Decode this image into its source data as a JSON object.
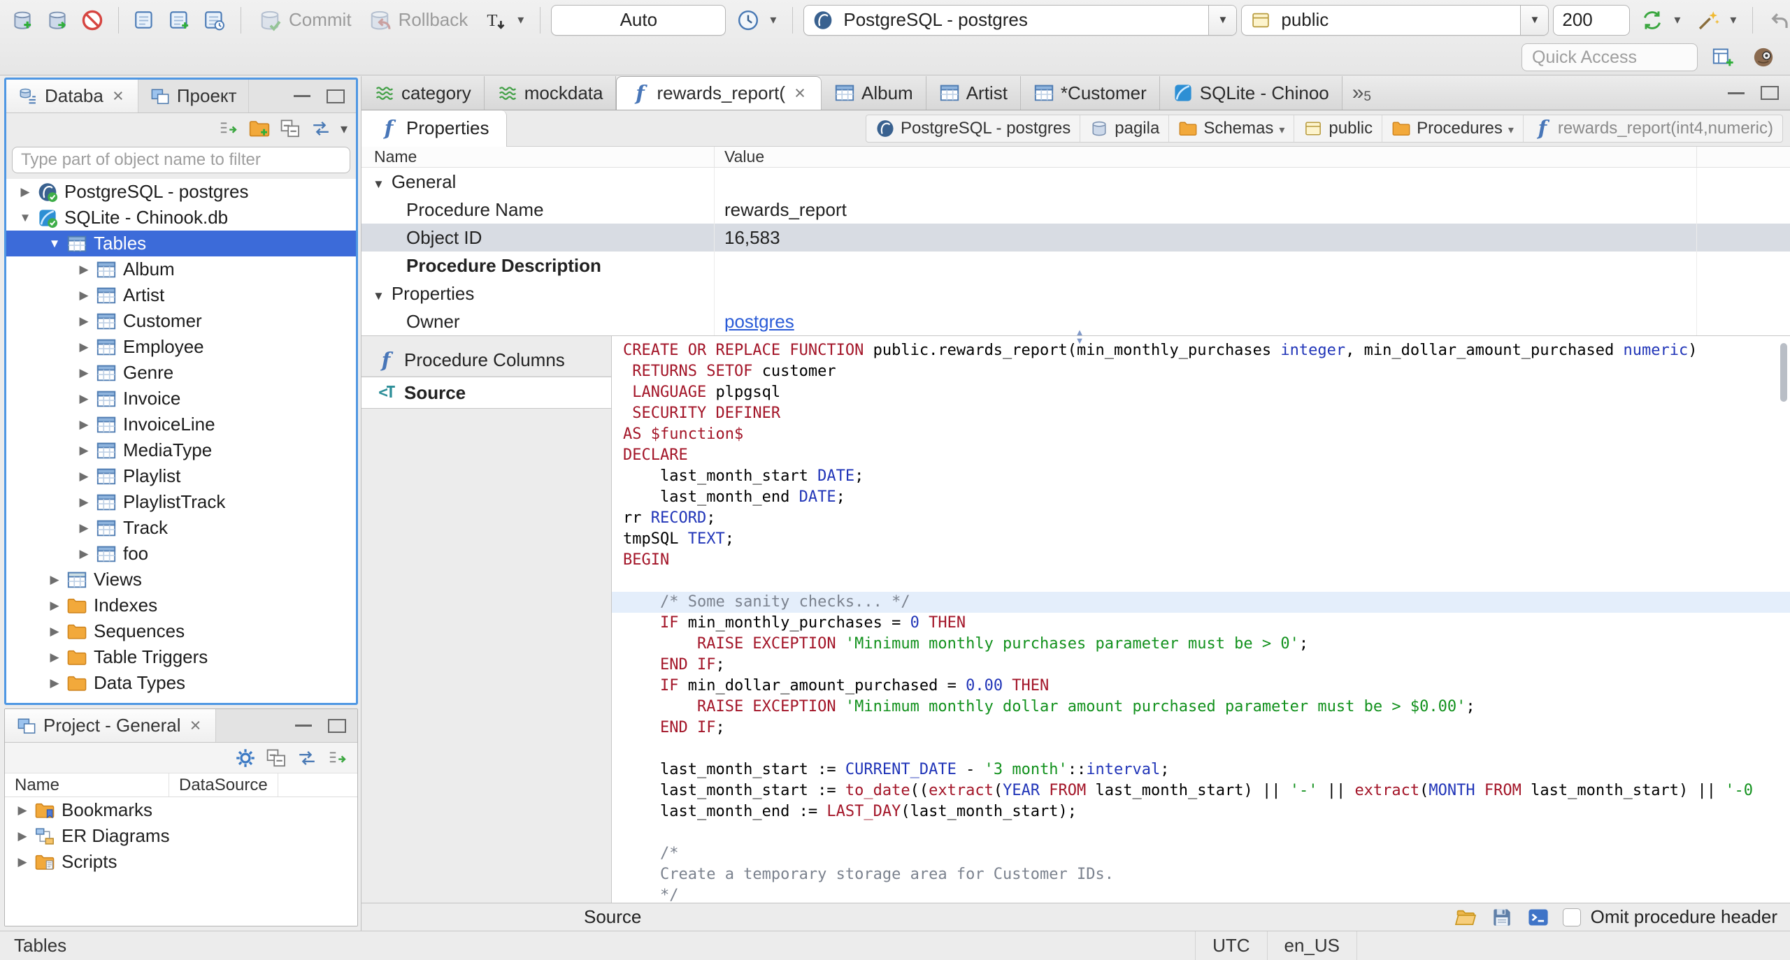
{
  "toolbar": {
    "commit_label": "Commit",
    "rollback_label": "Rollback",
    "auto_label": "Auto",
    "connection_value": "PostgreSQL - postgres",
    "schema_value": "public",
    "fetch_size": "200",
    "quick_access_placeholder": "Quick Access"
  },
  "sidebar": {
    "tabs": [
      {
        "label": "Databa",
        "icon": "db-navigator-icon",
        "active": true,
        "closable": true
      },
      {
        "label": "Проект",
        "icon": "projects-icon",
        "active": false,
        "closable": false
      }
    ],
    "filter_placeholder": "Type part of object name to filter",
    "tree": [
      {
        "label": "PostgreSQL - postgres",
        "icon": "postgresql-db-icon",
        "depth": 0,
        "state": "collapsed"
      },
      {
        "label": "SQLite - Chinook.db",
        "icon": "sqlite-db-icon",
        "depth": 0,
        "state": "expanded"
      },
      {
        "label": "Tables",
        "icon": "table-icon",
        "depth": 1,
        "state": "expanded",
        "selected": true
      },
      {
        "label": "Album",
        "icon": "table-icon",
        "depth": 2,
        "state": "collapsed"
      },
      {
        "label": "Artist",
        "icon": "table-icon",
        "depth": 2,
        "state": "collapsed"
      },
      {
        "label": "Customer",
        "icon": "table-icon",
        "depth": 2,
        "state": "collapsed"
      },
      {
        "label": "Employee",
        "icon": "table-icon",
        "depth": 2,
        "state": "collapsed"
      },
      {
        "label": "Genre",
        "icon": "table-icon",
        "depth": 2,
        "state": "collapsed"
      },
      {
        "label": "Invoice",
        "icon": "table-icon",
        "depth": 2,
        "state": "collapsed"
      },
      {
        "label": "InvoiceLine",
        "icon": "table-icon",
        "depth": 2,
        "state": "collapsed"
      },
      {
        "label": "MediaType",
        "icon": "table-icon",
        "depth": 2,
        "state": "collapsed"
      },
      {
        "label": "Playlist",
        "icon": "table-icon",
        "depth": 2,
        "state": "collapsed"
      },
      {
        "label": "PlaylistTrack",
        "icon": "table-icon",
        "depth": 2,
        "state": "collapsed"
      },
      {
        "label": "Track",
        "icon": "table-icon",
        "depth": 2,
        "state": "collapsed"
      },
      {
        "label": "foo",
        "icon": "table-icon",
        "depth": 2,
        "state": "collapsed"
      },
      {
        "label": "Views",
        "icon": "view-icon",
        "depth": 1,
        "state": "collapsed"
      },
      {
        "label": "Indexes",
        "icon": "folder-icon",
        "depth": 1,
        "state": "collapsed"
      },
      {
        "label": "Sequences",
        "icon": "folder-icon",
        "depth": 1,
        "state": "collapsed"
      },
      {
        "label": "Table Triggers",
        "icon": "folder-icon",
        "depth": 1,
        "state": "collapsed"
      },
      {
        "label": "Data Types",
        "icon": "folder-icon",
        "depth": 1,
        "state": "collapsed"
      }
    ]
  },
  "project_panel": {
    "title": "Project - General",
    "columns": [
      "Name",
      "DataSource"
    ],
    "items": [
      {
        "label": "Bookmarks",
        "icon": "bookmarks-folder-icon"
      },
      {
        "label": "ER Diagrams",
        "icon": "er-diagram-icon"
      },
      {
        "label": "Scripts",
        "icon": "scripts-folder-icon"
      }
    ]
  },
  "editor": {
    "tabs": [
      {
        "label": "category",
        "icon": "mockdata-icon"
      },
      {
        "label": "mockdata",
        "icon": "mockdata-icon"
      },
      {
        "label": "rewards_report(",
        "icon": "function-icon",
        "active": true,
        "closable": true
      },
      {
        "label": "Album",
        "icon": "table-icon"
      },
      {
        "label": "Artist",
        "icon": "table-icon"
      },
      {
        "label": "*Customer",
        "icon": "table-icon"
      },
      {
        "label": "SQLite - Chinoo",
        "icon": "sqlite-icon"
      }
    ],
    "tabs_overflow_count": "5",
    "properties_tab_label": "Properties",
    "breadcrumb": [
      {
        "label": "PostgreSQL - postgres",
        "icon": "postgresql-icon"
      },
      {
        "label": "pagila",
        "icon": "database-icon"
      },
      {
        "label": "Schemas",
        "icon": "folder-icon",
        "dropdown": true
      },
      {
        "label": "public",
        "icon": "schema-icon"
      },
      {
        "label": "Procedures",
        "icon": "folder-icon",
        "dropdown": true
      },
      {
        "label": "rewards_report(int4,numeric)",
        "icon": "function-icon",
        "muted": true
      }
    ],
    "grid": {
      "columns": [
        "Name",
        "Value"
      ],
      "rows": [
        {
          "type": "group",
          "name": "General"
        },
        {
          "type": "row",
          "name": "Procedure Name",
          "value": "rewards_report"
        },
        {
          "type": "row",
          "name": "Object ID",
          "value": "16,583",
          "selected": true
        },
        {
          "type": "row",
          "name": "Procedure Description",
          "value": "",
          "bold": true
        },
        {
          "type": "group",
          "name": "Properties"
        },
        {
          "type": "row",
          "name": "Owner",
          "value": "postgres",
          "link": true
        }
      ]
    },
    "subtabs": [
      {
        "label": "Procedure Columns",
        "icon": "function-icon"
      },
      {
        "label": "Source",
        "icon": "source-icon",
        "selected": true
      }
    ],
    "source": {
      "lines": [
        {
          "seg": [
            {
              "c": "k",
              "t": "CREATE OR REPLACE FUNCTION "
            },
            {
              "c": "i",
              "t": "public.rewards_report(min_monthly_purchases "
            },
            {
              "c": "t",
              "t": "integer"
            },
            {
              "c": "i",
              "t": ", min_dollar_amount_purchased "
            },
            {
              "c": "t",
              "t": "numeric"
            },
            {
              "c": "i",
              "t": ")"
            }
          ]
        },
        {
          "seg": [
            {
              "c": "k",
              "t": " RETURNS SETOF "
            },
            {
              "c": "i",
              "t": "customer"
            }
          ]
        },
        {
          "seg": [
            {
              "c": "k",
              "t": " LANGUAGE "
            },
            {
              "c": "i",
              "t": "plpgsql"
            }
          ]
        },
        {
          "seg": [
            {
              "c": "k",
              "t": " SECURITY DEFINER"
            }
          ]
        },
        {
          "seg": [
            {
              "c": "k",
              "t": "AS $function$"
            }
          ]
        },
        {
          "seg": [
            {
              "c": "k",
              "t": "DECLARE"
            }
          ]
        },
        {
          "seg": [
            {
              "c": "i",
              "t": "    last_month_start "
            },
            {
              "c": "t",
              "t": "DATE"
            },
            {
              "c": "i",
              "t": ";"
            }
          ]
        },
        {
          "seg": [
            {
              "c": "i",
              "t": "    last_month_end "
            },
            {
              "c": "t",
              "t": "DATE"
            },
            {
              "c": "i",
              "t": ";"
            }
          ]
        },
        {
          "seg": [
            {
              "c": "i",
              "t": "rr "
            },
            {
              "c": "t",
              "t": "RECORD"
            },
            {
              "c": "i",
              "t": ";"
            }
          ]
        },
        {
          "seg": [
            {
              "c": "i",
              "t": "tmpSQL "
            },
            {
              "c": "t",
              "t": "TEXT"
            },
            {
              "c": "i",
              "t": ";"
            }
          ]
        },
        {
          "seg": [
            {
              "c": "k",
              "t": "BEGIN"
            }
          ]
        },
        {
          "seg": []
        },
        {
          "hl": true,
          "seg": [
            {
              "c": "c",
              "t": "    /* Some sanity checks... */"
            }
          ]
        },
        {
          "seg": [
            {
              "c": "k",
              "t": "    IF "
            },
            {
              "c": "i",
              "t": "min_monthly_purchases = "
            },
            {
              "c": "n",
              "t": "0"
            },
            {
              "c": "k",
              "t": " THEN"
            }
          ]
        },
        {
          "seg": [
            {
              "c": "k",
              "t": "        RAISE EXCEPTION "
            },
            {
              "c": "s",
              "t": "'Minimum monthly purchases parameter must be > 0'"
            },
            {
              "c": "i",
              "t": ";"
            }
          ]
        },
        {
          "seg": [
            {
              "c": "k",
              "t": "    END IF"
            },
            {
              "c": "i",
              "t": ";"
            }
          ]
        },
        {
          "seg": [
            {
              "c": "k",
              "t": "    IF "
            },
            {
              "c": "i",
              "t": "min_dollar_amount_purchased = "
            },
            {
              "c": "n",
              "t": "0.00"
            },
            {
              "c": "k",
              "t": " THEN"
            }
          ]
        },
        {
          "seg": [
            {
              "c": "k",
              "t": "        RAISE EXCEPTION "
            },
            {
              "c": "s",
              "t": "'Minimum monthly dollar amount purchased parameter must be > $0.00'"
            },
            {
              "c": "i",
              "t": ";"
            }
          ]
        },
        {
          "seg": [
            {
              "c": "k",
              "t": "    END IF"
            },
            {
              "c": "i",
              "t": ";"
            }
          ]
        },
        {
          "seg": []
        },
        {
          "seg": [
            {
              "c": "i",
              "t": "    last_month_start := "
            },
            {
              "c": "t",
              "t": "CURRENT_DATE"
            },
            {
              "c": "i",
              "t": " - "
            },
            {
              "c": "s",
              "t": "'3 month'"
            },
            {
              "c": "i",
              "t": "::"
            },
            {
              "c": "t",
              "t": "interval"
            },
            {
              "c": "i",
              "t": ";"
            }
          ]
        },
        {
          "seg": [
            {
              "c": "i",
              "t": "    last_month_start := "
            },
            {
              "c": "k",
              "t": "to_date"
            },
            {
              "c": "i",
              "t": "(("
            },
            {
              "c": "k",
              "t": "extract"
            },
            {
              "c": "i",
              "t": "("
            },
            {
              "c": "t",
              "t": "YEAR"
            },
            {
              "c": "k",
              "t": " FROM "
            },
            {
              "c": "i",
              "t": "last_month_start) || "
            },
            {
              "c": "s",
              "t": "'-'"
            },
            {
              "c": "i",
              "t": " || "
            },
            {
              "c": "k",
              "t": "extract"
            },
            {
              "c": "i",
              "t": "("
            },
            {
              "c": "t",
              "t": "MONTH"
            },
            {
              "c": "k",
              "t": " FROM "
            },
            {
              "c": "i",
              "t": "last_month_start) || "
            },
            {
              "c": "s",
              "t": "'-0"
            }
          ]
        },
        {
          "seg": [
            {
              "c": "i",
              "t": "    last_month_end := "
            },
            {
              "c": "k",
              "t": "LAST_DAY"
            },
            {
              "c": "i",
              "t": "(last_month_start);"
            }
          ]
        },
        {
          "seg": []
        },
        {
          "seg": [
            {
              "c": "c",
              "t": "    /*"
            }
          ]
        },
        {
          "seg": [
            {
              "c": "c",
              "t": "    Create a temporary storage area for Customer IDs."
            }
          ]
        },
        {
          "seg": [
            {
              "c": "c",
              "t": "    */"
            }
          ]
        }
      ]
    },
    "bottom_bar": {
      "label": "Source",
      "checkbox_label": "Omit procedure header"
    }
  },
  "status_bar": {
    "selection": "Tables",
    "timezone": "UTC",
    "locale": "en_US"
  }
}
